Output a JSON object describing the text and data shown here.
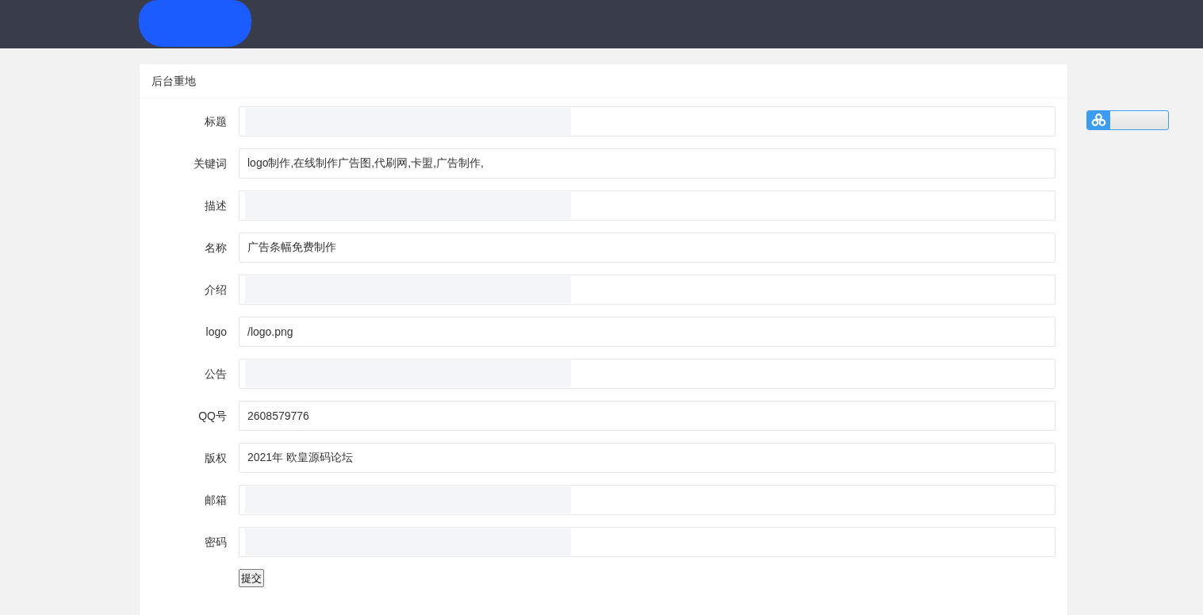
{
  "card": {
    "title": "后台重地"
  },
  "form": {
    "fields": [
      {
        "label": "标题",
        "redacted": true
      },
      {
        "label": "关键词",
        "value": "logo制作,在线制作广告图,代刷网,卡盟,广告制作,",
        "redacted": false
      },
      {
        "label": "描述",
        "redacted": true
      },
      {
        "label": "名称",
        "value": "广告条幅免费制作",
        "redacted": false
      },
      {
        "label": "介绍",
        "redacted": true
      },
      {
        "label": "logo",
        "value": "/logo.png",
        "redacted": false
      },
      {
        "label": "公告",
        "redacted": true
      },
      {
        "label": "QQ号",
        "value": "2608579776",
        "redacted": false
      },
      {
        "label": "版权",
        "value": "2021年 欧皇源码论坛",
        "redacted": false
      },
      {
        "label": "邮箱",
        "redacted": true
      },
      {
        "label": "密码",
        "redacted": true
      }
    ],
    "submit": "提交"
  }
}
